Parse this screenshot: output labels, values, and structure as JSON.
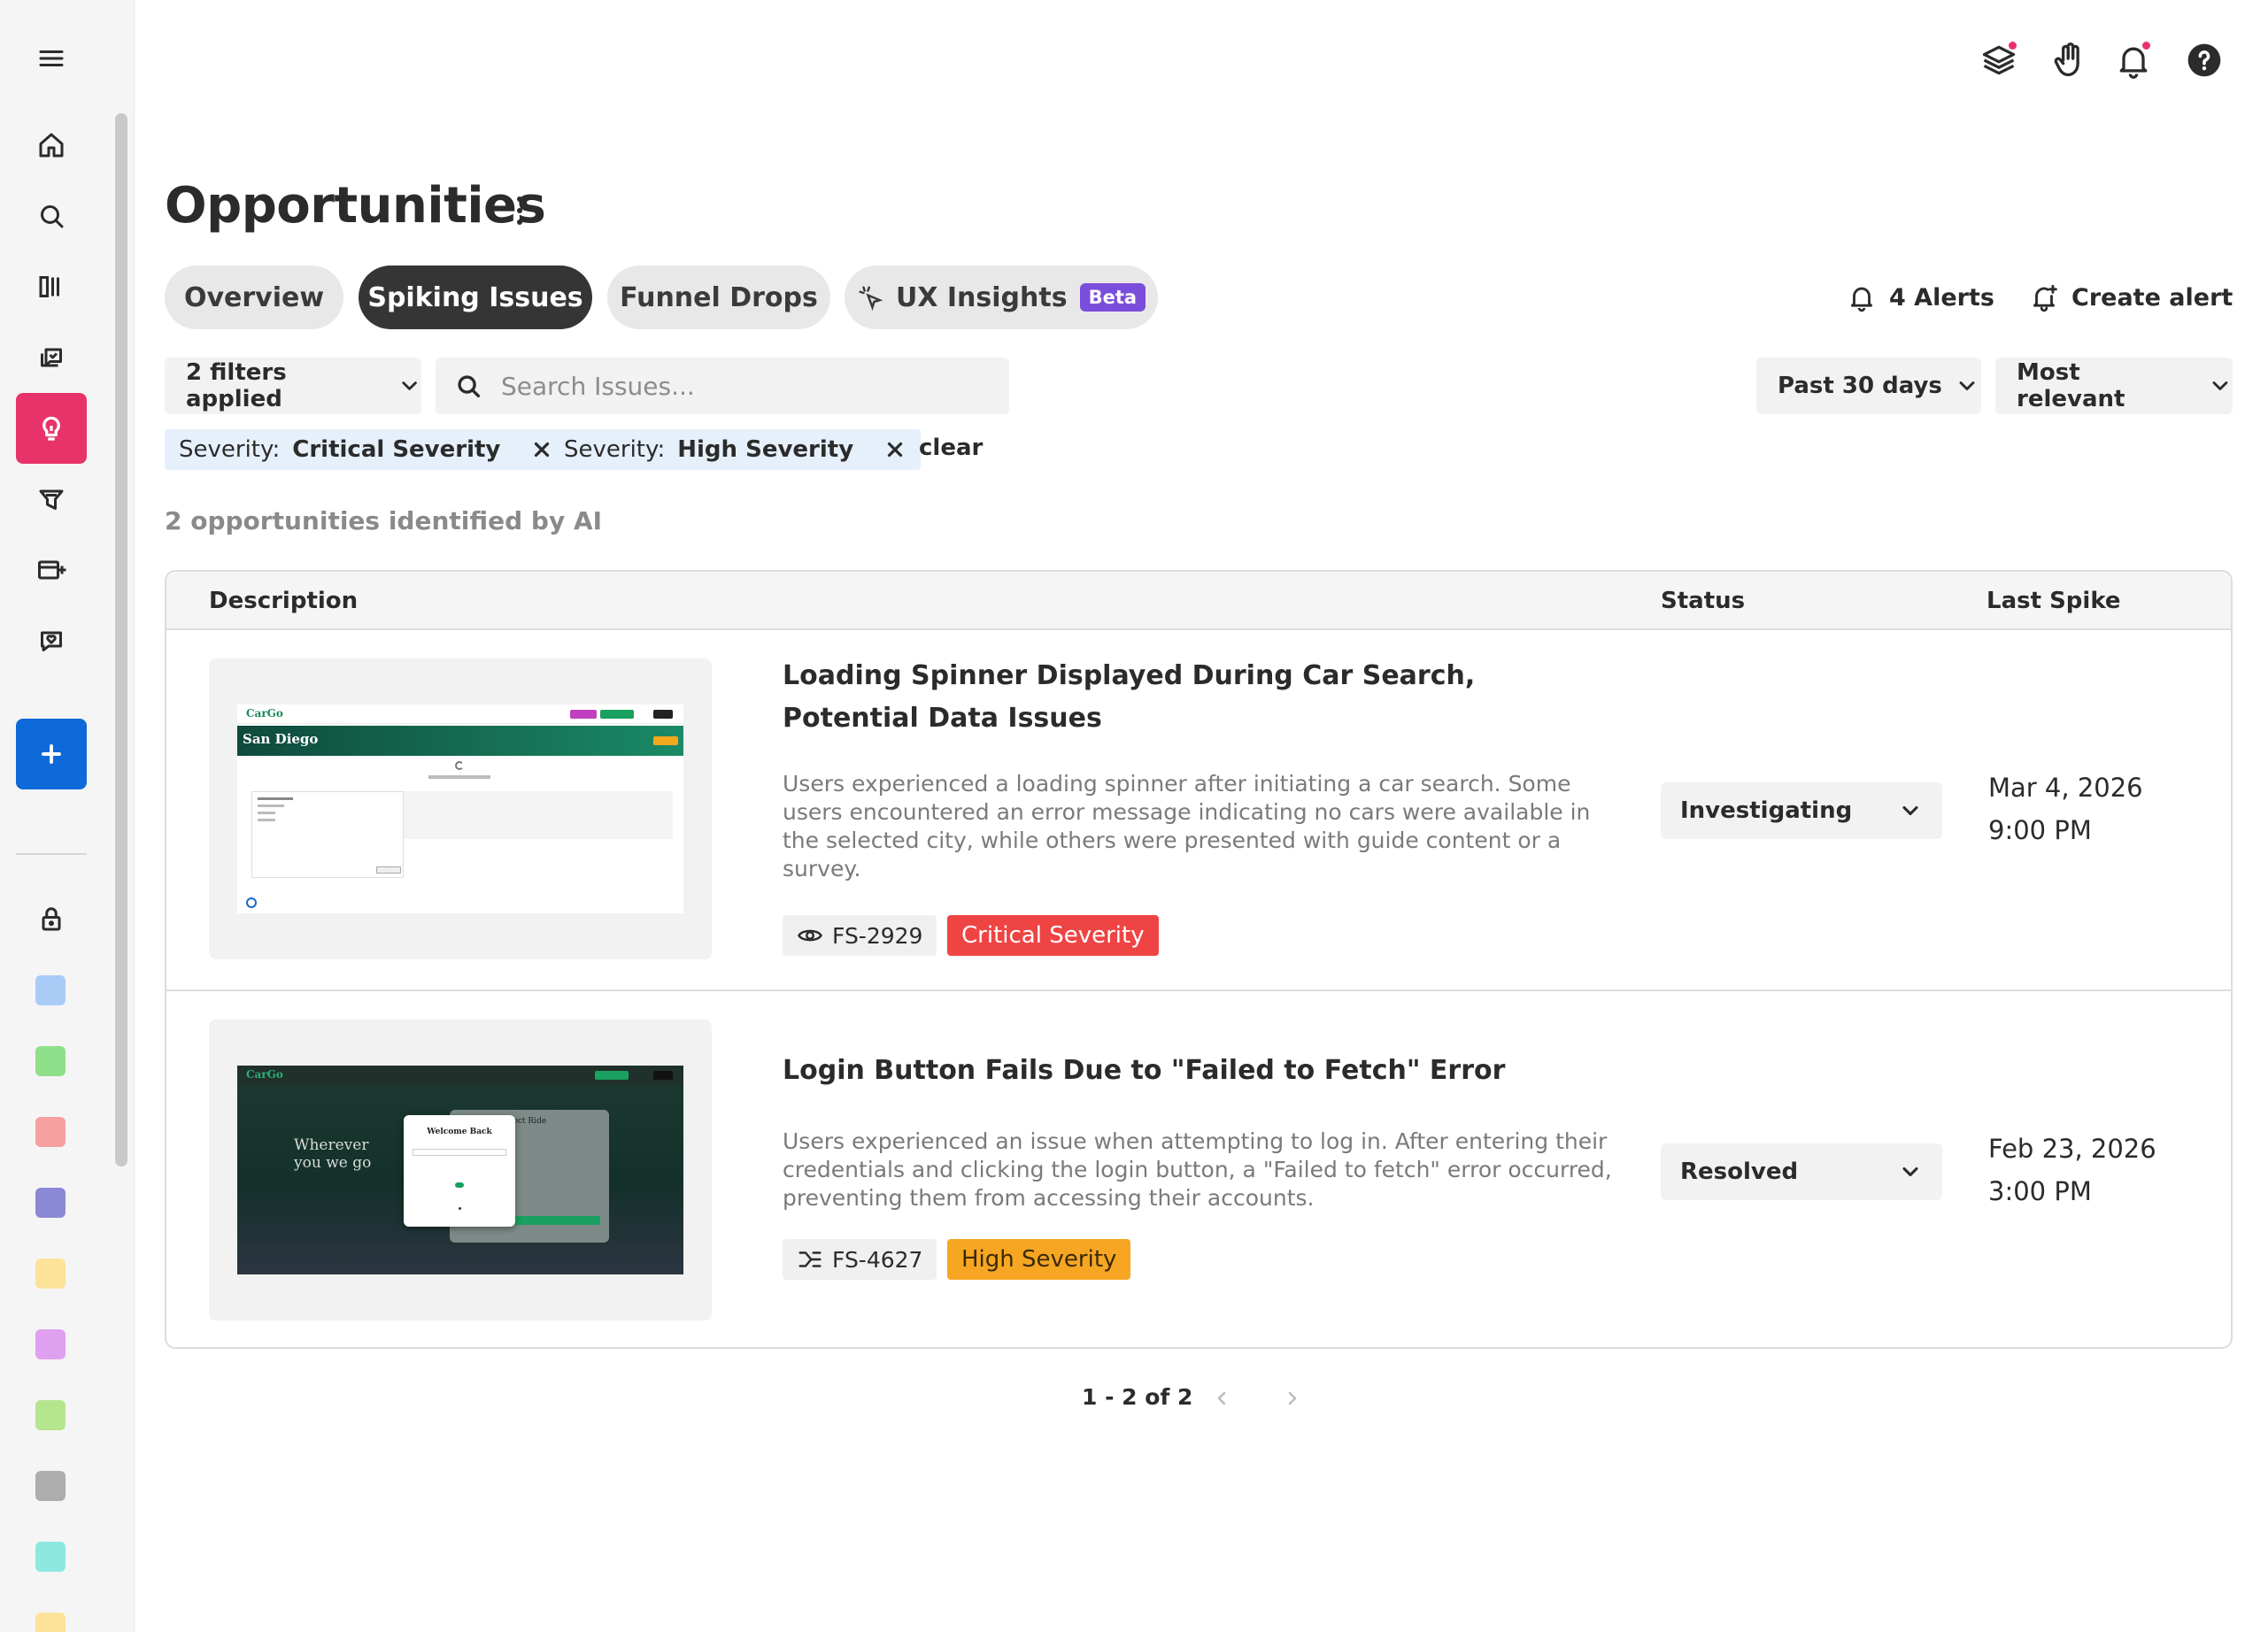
{
  "header": {
    "title": "Opportunities"
  },
  "tabs": [
    {
      "label": "Overview",
      "active": false
    },
    {
      "label": "Spiking Issues",
      "active": true
    },
    {
      "label": "Funnel Drops",
      "active": false
    },
    {
      "label": "UX Insights",
      "badge": "Beta",
      "active": false
    }
  ],
  "actions": {
    "alerts_label": "4 Alerts",
    "create_alert_label": "Create alert"
  },
  "filters": {
    "applied_label": "2 filters applied",
    "search_placeholder": "Search Issues...",
    "date_range": "Past 30 days",
    "sort": "Most relevant",
    "chips": [
      {
        "key": "Severity:",
        "value": "Critical Severity"
      },
      {
        "key": "Severity:",
        "value": "High Severity"
      }
    ],
    "clear_label": "clear"
  },
  "summary": "2 opportunities identified by AI",
  "table": {
    "columns": [
      "Description",
      "Status",
      "Last Spike"
    ],
    "rows": [
      {
        "title": "Loading Spinner Displayed During Car Search, Potential Data Issues",
        "description": "Users experienced a loading spinner after initiating a car search. Some users encountered an error message indicating no cars were available in the selected city, while others were presented with guide content or a survey.",
        "id": "FS-2929",
        "id_icon": "eye-icon",
        "severity": "Critical Severity",
        "status": "Investigating",
        "spike_date": "Mar 4, 2026",
        "spike_time": "9:00 PM",
        "thumb": {
          "brand": "CarGo",
          "heading": "San Diego"
        }
      },
      {
        "title": "Login Button Fails Due to \"Failed to Fetch\" Error",
        "description": "Users experienced an issue when attempting to log in. After entering their credentials and clicking the login button, a \"Failed to fetch\" error occurred, preventing them from accessing their accounts.",
        "id": "FS-4627",
        "id_icon": "funnel-merge-icon",
        "severity": "High Severity",
        "status": "Resolved",
        "spike_date": "Feb 23, 2026",
        "spike_time": "3:00 PM",
        "thumb": {
          "brand": "CarGo",
          "heading": "Wherever you we go",
          "modal_title": "Welcome Back",
          "card_title": "ur Perfect Ride"
        }
      }
    ]
  },
  "pagination": {
    "label": "1 - 2 of 2"
  },
  "colors": {
    "accent_active_nav": "#e8336a",
    "add_button": "#0d6ad8",
    "critical": "#ef4444",
    "high": "#f6a623",
    "beta": "#7b4ddb",
    "sidebar_swatches": [
      "#a9ccf7",
      "#8fe08a",
      "#f7a0a0",
      "#8b89d6",
      "#fde39a",
      "#e0a0f0",
      "#b5e68e",
      "#adadad",
      "#8de8e0",
      "#fde39a"
    ]
  }
}
